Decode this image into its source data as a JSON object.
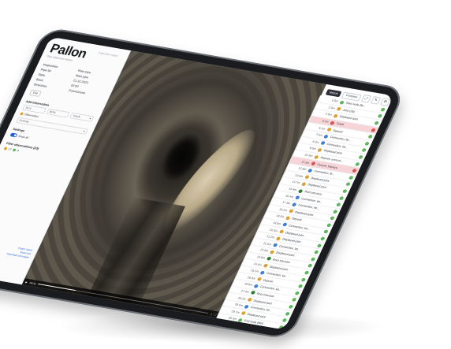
{
  "app": {
    "logo": "Pallon",
    "subtitle": "Pipe inspection viewer",
    "breadcrumb": "Inspection report"
  },
  "meta": [
    {
      "k": "Inspection",
      "v": "Main pipe"
    },
    {
      "k": "Pipe ID",
      "v": "Main pipe"
    },
    {
      "k": "Date",
      "v": "21.10.2023"
    },
    {
      "k": "Start",
      "v": "00:00"
    },
    {
      "k": "Direction",
      "v": "Downstream"
    }
  ],
  "left": {
    "edit_button": "Edit",
    "section_observations": "Add observation",
    "field_distance": "10 m",
    "field_time": "00:41",
    "field_code": "Crack",
    "field_severity": "Severity",
    "chip_label": "Observation",
    "section_settings": "Settings",
    "toggle_label": "Show all",
    "section_filter": "Filter observations (23)",
    "filters": [
      "17",
      "6"
    ],
    "links": [
      "Export report",
      "Share link",
      "Download all images"
    ]
  },
  "toolbar": {
    "report": "Report",
    "compare": "Compare",
    "icons": [
      "fullscreen-icon",
      "edit-icon",
      "settings-icon"
    ]
  },
  "video": {
    "time": "00:41",
    "progress": 0.22
  },
  "colors": {
    "accent": "#1f5fd6",
    "danger": "#d9534f",
    "ok": "#5cb85c",
    "warn": "#e0a030",
    "highlight": "#f6d4d8"
  },
  "observations": [
    {
      "d": "0.0m",
      "t": "Start node (M...",
      "i": "#5cb85c",
      "s": "#5cb85c",
      "hl": false
    },
    {
      "d": "2.3m",
      "t": "Joint (JN)",
      "i": "#e0a030",
      "s": "#5cb85c",
      "hl": false
    },
    {
      "d": "4.9m",
      "t": "Displaced joint",
      "i": "#e0a030",
      "s": "#5cb85c",
      "hl": false
    },
    {
      "d": "5.4m",
      "t": "Crack",
      "i": "#d9534f",
      "s": "#d9534f",
      "hl": true
    },
    {
      "d": "6.1m",
      "t": "Deposit",
      "i": "#e0a030",
      "s": "#5cb85c",
      "hl": false
    },
    {
      "d": "7.0m",
      "t": "Connection, lat...",
      "i": "#3f7fd9",
      "s": "#5cb85c",
      "hl": false
    },
    {
      "d": "8.2m",
      "t": "Connection, lat...",
      "i": "#3f7fd9",
      "s": "#5cb85c",
      "hl": false
    },
    {
      "d": "9.6m",
      "t": "Displaced joint",
      "i": "#e0a030",
      "s": "#5cb85c",
      "hl": false
    },
    {
      "d": "10.3m",
      "t": "Deposit, encrust...",
      "i": "#e0a030",
      "s": "#5cb85c",
      "hl": false
    },
    {
      "d": "11.5m",
      "t": "Fissure, fracture",
      "i": "#d9534f",
      "s": "#d9534f",
      "hl": true
    },
    {
      "d": "12.8m",
      "t": "Connection, fit...",
      "i": "#3f7fd9",
      "s": "#5cb85c",
      "hl": false
    },
    {
      "d": "13.9m",
      "t": "Displaced joint",
      "i": "#e0a030",
      "s": "#5cb85c",
      "hl": false
    },
    {
      "d": "14.7m",
      "t": "Displaced joint",
      "i": "#e0a030",
      "s": "#5cb85c",
      "hl": false
    },
    {
      "d": "15.6m",
      "t": "Root intrusion",
      "i": "#2e7d32",
      "s": "#5cb85c",
      "hl": false
    },
    {
      "d": "16.4m",
      "t": "Connection, lat...",
      "i": "#3f7fd9",
      "s": "#5cb85c",
      "hl": false
    },
    {
      "d": "17.3m",
      "t": "Connection, lat...",
      "i": "#3f7fd9",
      "s": "#5cb85c",
      "hl": false
    },
    {
      "d": "18.1m",
      "t": "Displaced joint",
      "i": "#e0a030",
      "s": "#5cb85c",
      "hl": false
    },
    {
      "d": "19.0m",
      "t": "Deposit",
      "i": "#e0a030",
      "s": "#5cb85c",
      "hl": false
    },
    {
      "d": "19.8m",
      "t": "Connection, lat...",
      "i": "#3f7fd9",
      "s": "#5cb85c",
      "hl": false
    },
    {
      "d": "20.5m",
      "t": "Displaced joint",
      "i": "#e0a030",
      "s": "#5cb85c",
      "hl": false
    },
    {
      "d": "21.2m",
      "t": "Displaced joint",
      "i": "#e0a030",
      "s": "#5cb85c",
      "hl": false
    },
    {
      "d": "22.0m",
      "t": "Connection, lat...",
      "i": "#3f7fd9",
      "s": "#5cb85c",
      "hl": false
    },
    {
      "d": "22.9m",
      "t": "Displaced joint",
      "i": "#e0a030",
      "s": "#5cb85c",
      "hl": false
    },
    {
      "d": "23.6m",
      "t": "Root intrusion",
      "i": "#2e7d32",
      "s": "#5cb85c",
      "hl": false
    },
    {
      "d": "24.5m",
      "t": "Displaced joint",
      "i": "#e0a030",
      "s": "#5cb85c",
      "hl": false
    },
    {
      "d": "25.1m",
      "t": "Connection, lat...",
      "i": "#3f7fd9",
      "s": "#5cb85c",
      "hl": false
    },
    {
      "d": "26.0m",
      "t": "Deposit",
      "i": "#e0a030",
      "s": "#5cb85c",
      "hl": false
    },
    {
      "d": "26.8m",
      "t": "Connection, lat...",
      "i": "#3f7fd9",
      "s": "#5cb85c",
      "hl": false
    },
    {
      "d": "27.4m",
      "t": "Root intrusion",
      "i": "#2e7d32",
      "s": "#5cb85c",
      "hl": false
    },
    {
      "d": "28.2m",
      "t": "Displaced joint",
      "i": "#e0a030",
      "s": "#5cb85c",
      "hl": false
    },
    {
      "d": "29.0m",
      "t": "Connection, lat...",
      "i": "#3f7fd9",
      "s": "#5cb85c",
      "hl": false
    },
    {
      "d": "29.7m",
      "t": "Displaced joint",
      "i": "#e0a030",
      "s": "#5cb85c",
      "hl": false
    },
    {
      "d": "30.4m",
      "t": "End node (MH)",
      "i": "#5cb85c",
      "s": "#5cb85c",
      "hl": false
    }
  ]
}
